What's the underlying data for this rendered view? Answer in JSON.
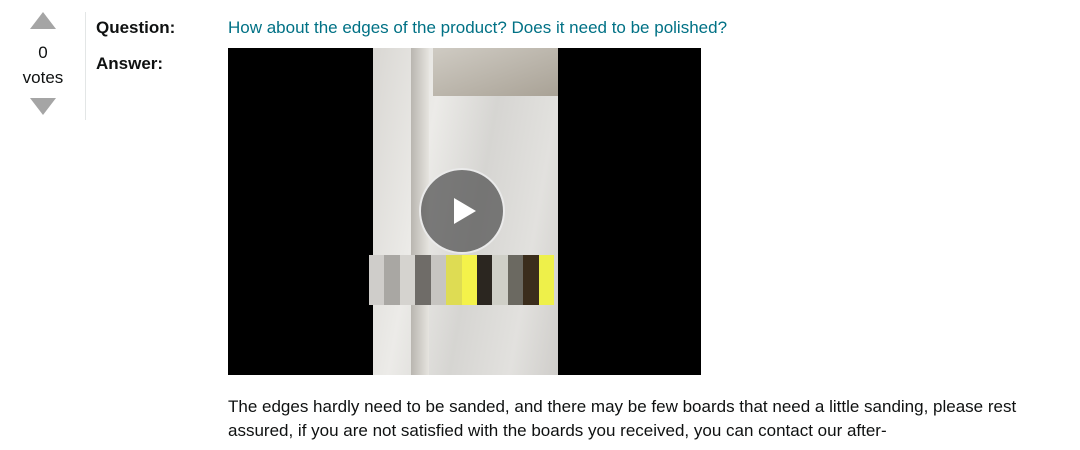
{
  "vote": {
    "count": "0",
    "label": "votes"
  },
  "question": {
    "label": "Question:",
    "text": "How about the edges of the product? Does it need to be polished?"
  },
  "answer": {
    "label": "Answer:",
    "text": "The edges hardly need to be sanded, and there may be few boards that need a little sanding, please rest assured, if you are not satisfied with the boards you received, you can contact our after-"
  },
  "video": {
    "play_icon": "play-icon"
  },
  "colors": {
    "link": "#007185",
    "vote_arrow": "#a5a5a5",
    "text": "#0f1111"
  }
}
